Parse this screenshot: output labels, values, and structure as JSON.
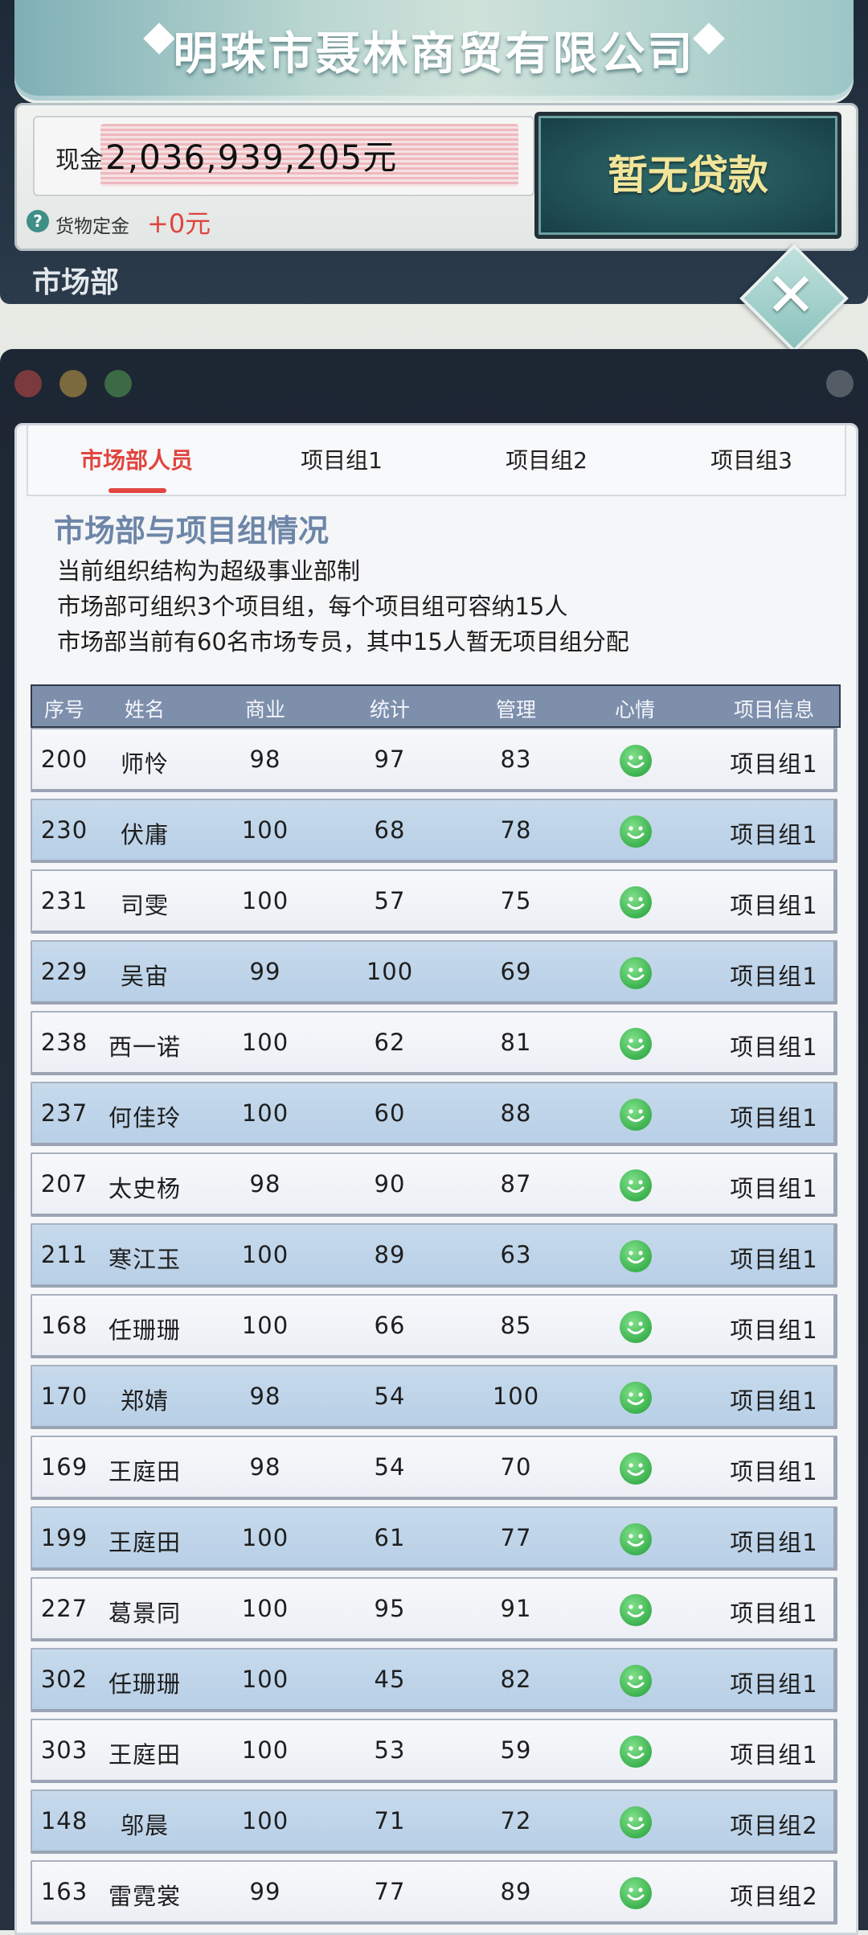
{
  "header": {
    "company_name": "明珠市聂林商贸有限公司",
    "cash_label": "现金",
    "cash_value": "2,036,939,205元",
    "loan_button": "暂无贷款",
    "deposit_label": "货物定金",
    "deposit_value": "+0元",
    "department": "市场部",
    "help_icon": "question-icon",
    "close_icon": "close-icon"
  },
  "tabs": [
    "市场部人员",
    "项目组1",
    "项目组2",
    "项目组3"
  ],
  "active_tab": 0,
  "section": {
    "title": "市场部与项目组情况",
    "lines": [
      "当前组织结构为超级事业部制",
      "市场部可组织3个项目组，每个项目组可容纳15人",
      "市场部当前有60名市场专员，其中15人暂无项目组分配"
    ]
  },
  "table": {
    "headers": [
      "序号",
      "姓名",
      "商业",
      "统计",
      "管理",
      "心情",
      "项目信息"
    ],
    "rows": [
      {
        "id": "200",
        "name": "师怜",
        "business": "98",
        "stats": "97",
        "mgmt": "83",
        "mood": "happy",
        "project": "项目组1"
      },
      {
        "id": "230",
        "name": "伏庸",
        "business": "100",
        "stats": "68",
        "mgmt": "78",
        "mood": "happy",
        "project": "项目组1"
      },
      {
        "id": "231",
        "name": "司雯",
        "business": "100",
        "stats": "57",
        "mgmt": "75",
        "mood": "happy",
        "project": "项目组1"
      },
      {
        "id": "229",
        "name": "吴宙",
        "business": "99",
        "stats": "100",
        "mgmt": "69",
        "mood": "happy",
        "project": "项目组1"
      },
      {
        "id": "238",
        "name": "西一诺",
        "business": "100",
        "stats": "62",
        "mgmt": "81",
        "mood": "happy",
        "project": "项目组1"
      },
      {
        "id": "237",
        "name": "何佳玲",
        "business": "100",
        "stats": "60",
        "mgmt": "88",
        "mood": "happy",
        "project": "项目组1"
      },
      {
        "id": "207",
        "name": "太史杨",
        "business": "98",
        "stats": "90",
        "mgmt": "87",
        "mood": "happy",
        "project": "项目组1"
      },
      {
        "id": "211",
        "name": "寒江玉",
        "business": "100",
        "stats": "89",
        "mgmt": "63",
        "mood": "happy",
        "project": "项目组1"
      },
      {
        "id": "168",
        "name": "任珊珊",
        "business": "100",
        "stats": "66",
        "mgmt": "85",
        "mood": "happy",
        "project": "项目组1"
      },
      {
        "id": "170",
        "name": "郑婧",
        "business": "98",
        "stats": "54",
        "mgmt": "100",
        "mood": "happy",
        "project": "项目组1"
      },
      {
        "id": "169",
        "name": "王庭田",
        "business": "98",
        "stats": "54",
        "mgmt": "70",
        "mood": "happy",
        "project": "项目组1"
      },
      {
        "id": "199",
        "name": "王庭田",
        "business": "100",
        "stats": "61",
        "mgmt": "77",
        "mood": "happy",
        "project": "项目组1"
      },
      {
        "id": "227",
        "name": "葛景同",
        "business": "100",
        "stats": "95",
        "mgmt": "91",
        "mood": "happy",
        "project": "项目组1"
      },
      {
        "id": "302",
        "name": "任珊珊",
        "business": "100",
        "stats": "45",
        "mgmt": "82",
        "mood": "happy",
        "project": "项目组1"
      },
      {
        "id": "303",
        "name": "王庭田",
        "business": "100",
        "stats": "53",
        "mgmt": "59",
        "mood": "happy",
        "project": "项目组1"
      },
      {
        "id": "148",
        "name": "邬晨",
        "business": "100",
        "stats": "71",
        "mgmt": "72",
        "mood": "happy",
        "project": "项目组2"
      },
      {
        "id": "163",
        "name": "雷霓裳",
        "business": "99",
        "stats": "77",
        "mgmt": "89",
        "mood": "happy",
        "project": "项目组2"
      }
    ]
  },
  "colors": {
    "accent": "#e0453f",
    "header_bg": "#7e8fac",
    "mood_happy": "#3db24f"
  }
}
